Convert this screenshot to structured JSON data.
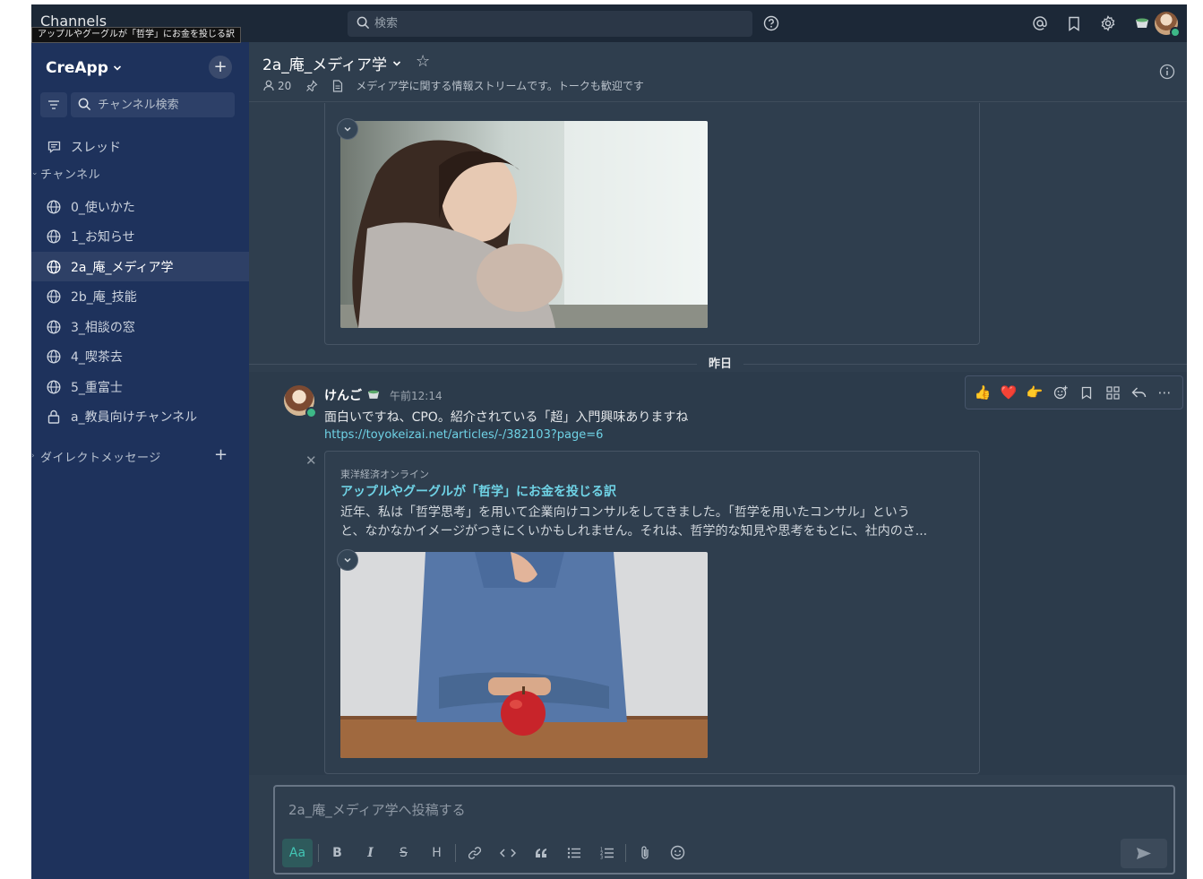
{
  "window": {
    "title": "Channels",
    "tooltip": "アップルやグーグルが「哲学」にお金を投じる訳"
  },
  "topbar": {
    "search_placeholder": "検索",
    "icons": [
      "help-icon",
      "at-mention-icon",
      "saved-icon",
      "settings-icon"
    ]
  },
  "sidebar": {
    "team_name": "CreApp",
    "search_placeholder": "チャンネル検索",
    "threads_label": "スレッド",
    "channels_section": "チャンネル",
    "channels": [
      {
        "label": "0_使いかた",
        "icon": "globe-icon",
        "active": false
      },
      {
        "label": "1_お知らせ",
        "icon": "globe-icon",
        "active": false
      },
      {
        "label": "2a_庵_メディア学",
        "icon": "globe-icon",
        "active": true
      },
      {
        "label": "2b_庵_技能",
        "icon": "globe-icon",
        "active": false
      },
      {
        "label": "3_相談の窓",
        "icon": "globe-icon",
        "active": false
      },
      {
        "label": "4_喫茶去",
        "icon": "globe-icon",
        "active": false
      },
      {
        "label": "5_重富士",
        "icon": "globe-icon",
        "active": false
      },
      {
        "label": "a_教員向けチャンネル",
        "icon": "lock-icon",
        "active": false
      }
    ],
    "dm_section": "ダイレクトメッセージ"
  },
  "channel": {
    "name": "2a_庵_メディア学",
    "member_count": "20",
    "purpose": "メディア学に関する情報ストリームです。トークも歓迎です"
  },
  "messages": {
    "date_separator": "昨日",
    "post": {
      "author": "けんご",
      "time": "午前12:14",
      "text": "面白いですね、CPO。紹介されている「超」入門興味ありますね",
      "link": "https://toyokeizai.net/articles/-/382103?page=6",
      "og": {
        "site": "東洋経済オンライン",
        "title": "アップルやグーグルが「哲学」にお金を投じる訳",
        "desc_line1": "近年、私は「哲学思考」を用いて企業向けコンサルをしてきました。「哲学を用いたコンサル」という",
        "desc_line2": "と、なかなかイメージがつきにくいかもしれません。それは、哲学的な知見や思考をもとに、社内のさ..."
      }
    },
    "reactions": [
      "thumbs-up-icon",
      "heart-icon",
      "pointing-hand-icon",
      "add-reaction-icon",
      "save-icon",
      "apps-icon",
      "reply-icon",
      "more-icon"
    ]
  },
  "composer": {
    "placeholder": "2a_庵_メディア学へ投稿する",
    "format_aa": "Aa",
    "format_bold": "B",
    "format_italic": "I",
    "format_strike": "S",
    "format_heading": "H"
  },
  "colors": {
    "accent": "#6fd3e6",
    "sidebar": "#1e325c",
    "online": "#3db887"
  }
}
